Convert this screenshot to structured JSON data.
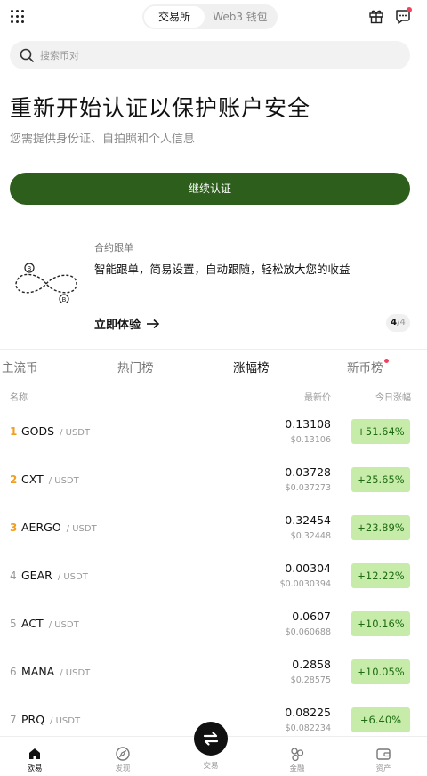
{
  "topbar": {
    "segments": [
      "交易所",
      "Web3 钱包"
    ],
    "active_segment": "交易所",
    "icons": [
      "grid-menu-icon",
      "gift-icon",
      "message-icon"
    ]
  },
  "search": {
    "placeholder": "搜索币对"
  },
  "hero": {
    "title": "重新开始认证以保护账户安全",
    "subtitle": "您需提供身份证、自拍照和个人信息",
    "cta_label": "继续认证"
  },
  "promo": {
    "tag": "合约跟单",
    "description": "智能跟单，简易设置，自动跟随，轻松放大您的收益",
    "link_label": "立即体验",
    "pager_current": "4",
    "pager_total": "/4"
  },
  "tabs": [
    "主流币",
    "热门榜",
    "涨幅榜",
    "新币榜"
  ],
  "active_tab": "涨幅榜",
  "table_header": {
    "name": "名称",
    "price": "最新价",
    "change": "今日涨幅"
  },
  "rows": [
    {
      "rank": "1",
      "symbol": "GODS",
      "quote": "/ USDT",
      "price": "0.13108",
      "fiat": "$0.13106",
      "change": "+51.64%"
    },
    {
      "rank": "2",
      "symbol": "CXT",
      "quote": "/ USDT",
      "price": "0.03728",
      "fiat": "$0.037273",
      "change": "+25.65%"
    },
    {
      "rank": "3",
      "symbol": "AERGO",
      "quote": "/ USDT",
      "price": "0.32454",
      "fiat": "$0.32448",
      "change": "+23.89%"
    },
    {
      "rank": "4",
      "symbol": "GEAR",
      "quote": "/ USDT",
      "price": "0.00304",
      "fiat": "$0.0030394",
      "change": "+12.22%"
    },
    {
      "rank": "5",
      "symbol": "ACT",
      "quote": "/ USDT",
      "price": "0.0607",
      "fiat": "$0.060688",
      "change": "+10.16%"
    },
    {
      "rank": "6",
      "symbol": "MANA",
      "quote": "/ USDT",
      "price": "0.2858",
      "fiat": "$0.28575",
      "change": "+10.05%"
    },
    {
      "rank": "7",
      "symbol": "PRQ",
      "quote": "/ USDT",
      "price": "0.08225",
      "fiat": "$0.082234",
      "change": "+6.40%"
    }
  ],
  "bottom_nav": [
    "欧易",
    "发现",
    "交易",
    "金融",
    "资产"
  ],
  "colors": {
    "brand_green": "#2d5e1b",
    "gain_bg": "#c7ecaa",
    "gain_text": "#1f6b12",
    "rank_gold": "#f0a020",
    "alert_red": "#f24060"
  }
}
